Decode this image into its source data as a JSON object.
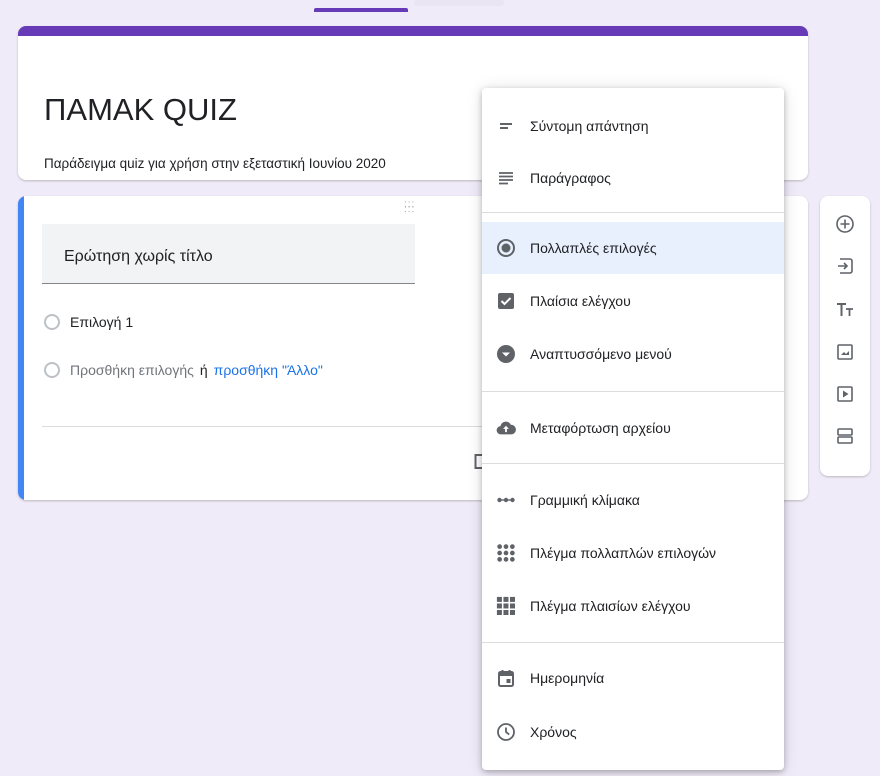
{
  "form": {
    "title": "ΠΑΜΑΚ QUIZ",
    "description": "Παράδειγμα quiz για χρήση στην εξεταστική Ιουνίου 2020"
  },
  "question": {
    "title": "Ερώτηση χωρίς τίτλο",
    "option_1": "Επιλογή 1",
    "add_option": "Προσθήκη επιλογής",
    "or_text": "ή",
    "add_other": "προσθήκη \"Άλλο\""
  },
  "type_menu": {
    "items": [
      {
        "label": "Σύντομη απάντηση",
        "icon": "short-answer-icon"
      },
      {
        "label": "Παράγραφος",
        "icon": "paragraph-icon"
      },
      {
        "label": "Πολλαπλές επιλογές",
        "icon": "radio-checked-icon",
        "selected": true
      },
      {
        "label": "Πλαίσια ελέγχου",
        "icon": "checkbox-icon"
      },
      {
        "label": "Αναπτυσσόμενο μενού",
        "icon": "dropdown-icon"
      },
      {
        "label": "Μεταφόρτωση αρχείου",
        "icon": "cloud-upload-icon"
      },
      {
        "label": "Γραμμική κλίμακα",
        "icon": "linear-scale-icon"
      },
      {
        "label": "Πλέγμα πολλαπλών επιλογών",
        "icon": "radio-grid-icon"
      },
      {
        "label": "Πλέγμα πλαισίων ελέγχου",
        "icon": "checkbox-grid-icon"
      },
      {
        "label": "Ημερομηνία",
        "icon": "calendar-icon"
      },
      {
        "label": "Χρόνος",
        "icon": "clock-icon"
      }
    ]
  },
  "toolbar": {
    "buttons": [
      "add-question-icon",
      "import-questions-icon",
      "add-title-icon",
      "add-image-icon",
      "add-video-icon",
      "add-section-icon"
    ]
  },
  "colors": {
    "theme": "#673ab7",
    "background": "#f0ebf8",
    "active_border": "#4285f4",
    "link": "#1a73e8",
    "selected_item": "#e8f0fe"
  }
}
